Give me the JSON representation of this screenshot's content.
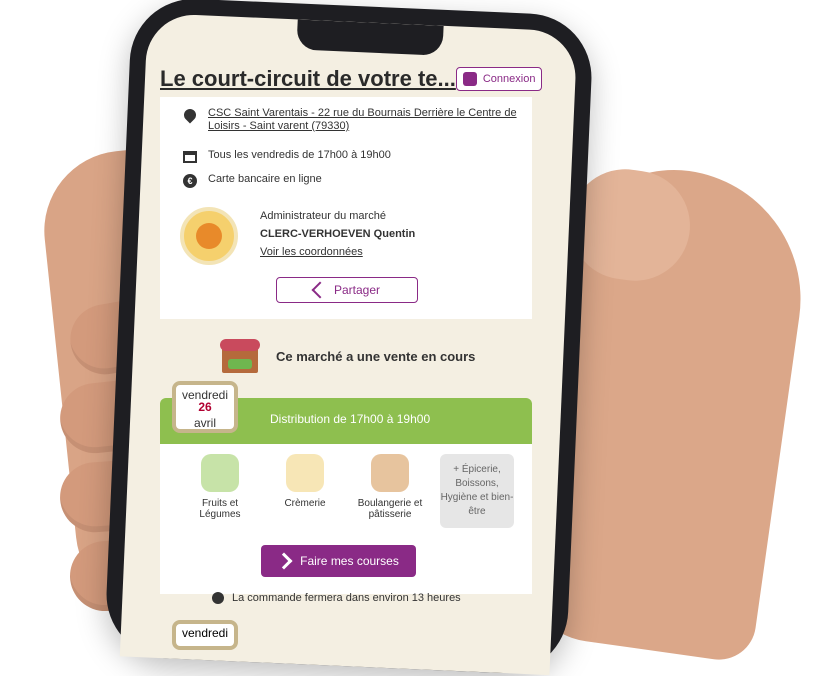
{
  "app": {
    "title": "Le court-circuit de votre te..."
  },
  "header": {
    "login_label": "Connexion"
  },
  "market": {
    "address": "CSC Saint Varentais - 22 rue du Bournais Derrière le Centre de Loisirs - Saint varent (79330)",
    "schedule": "Tous les vendredis de 17h00 à 19h00",
    "payment": "Carte bancaire en ligne",
    "admin": {
      "role": "Administrateur du marché",
      "name": "CLERC-VERHOEVEN Quentin",
      "link": "Voir les coordonnées"
    },
    "share_label": "Partager",
    "sale_status": "Ce marché a une vente en cours"
  },
  "distribution": {
    "date": {
      "weekday": "vendredi",
      "day": "26",
      "month": "avril"
    },
    "text": "Distribution de 17h00 à 19h00",
    "categories": [
      {
        "label": "Fruits et Légumes"
      },
      {
        "label": "Crèmerie"
      },
      {
        "label": "Boulangerie et pâtisserie"
      }
    ],
    "more": "+ Épicerie, Boissons, Hygiène et bien-être",
    "cta": "Faire mes courses",
    "closing": "La commande fermera dans environ 13 heures"
  },
  "next": {
    "weekday": "vendredi"
  }
}
